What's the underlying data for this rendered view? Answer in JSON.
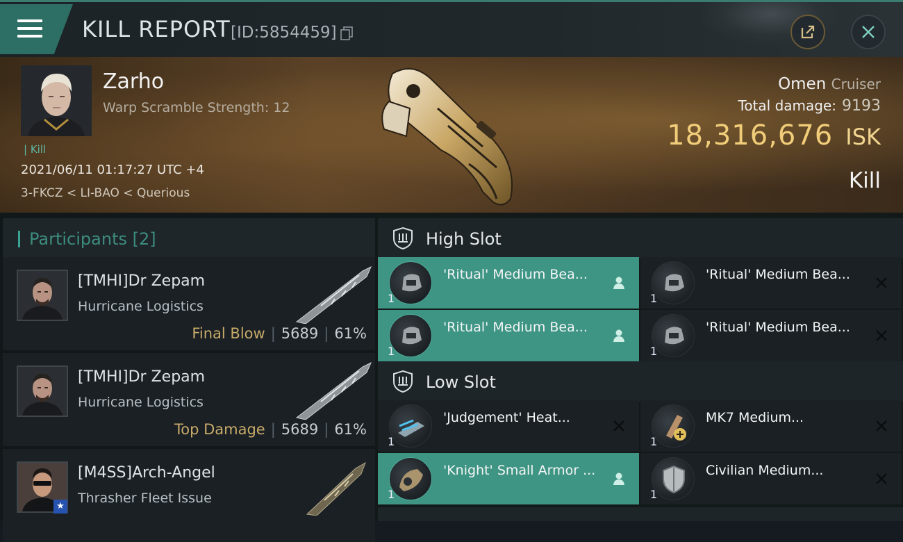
{
  "header": {
    "title": "KILL REPORT",
    "report_id": "[ID:5854459]"
  },
  "victim": {
    "name": "Zarho",
    "warp_scramble": "Warp Scramble Strength: 12",
    "kill_tag": "Kill",
    "datetime": "2021/06/11 01:17:27 UTC +4",
    "location": "3-FKCZ < LI-BAO < Querious",
    "ship": "Omen",
    "ship_class": "Cruiser",
    "total_damage_label": "Total damage:",
    "total_damage": "9193",
    "isk_value": "18,316,676",
    "isk_unit": "ISK",
    "result": "Kill"
  },
  "participants": {
    "label": "Participants",
    "count": "[2]",
    "rows": [
      {
        "name": "[TMHI]Dr Zepam",
        "ship": "Hurricane Logistics",
        "role": "Final Blow",
        "damage": "5689",
        "percent": "61%"
      },
      {
        "name": "[TMHI]Dr Zepam",
        "ship": "Hurricane Logistics",
        "role": "Top Damage",
        "damage": "5689",
        "percent": "61%"
      },
      {
        "name": "[M4SS]Arch-Angel",
        "ship": "Thrasher Fleet Issue"
      }
    ]
  },
  "slots": {
    "high": {
      "label": "High Slot",
      "items": [
        {
          "name": "'Ritual' Medium Bea...",
          "qty": "1",
          "state": "dropped"
        },
        {
          "name": "'Ritual' Medium Bea...",
          "qty": "1",
          "state": "destroyed"
        },
        {
          "name": "'Ritual' Medium Bea...",
          "qty": "1",
          "state": "dropped"
        },
        {
          "name": "'Ritual' Medium Bea...",
          "qty": "1",
          "state": "destroyed"
        }
      ]
    },
    "low": {
      "label": "Low Slot",
      "items": [
        {
          "name": "'Judgement' Heat...",
          "qty": "1",
          "state": "destroyed"
        },
        {
          "name": "MK7 Medium...",
          "qty": "1",
          "state": "destroyed"
        },
        {
          "name": "'Knight' Small Armor ...",
          "qty": "1",
          "state": "dropped"
        },
        {
          "name": "Civilian Medium...",
          "qty": "1",
          "state": "destroyed"
        }
      ]
    }
  },
  "colors": {
    "accent": "#3f9584",
    "isk_gold": "#f1cd7a",
    "role_gold": "#c9ab6a"
  }
}
